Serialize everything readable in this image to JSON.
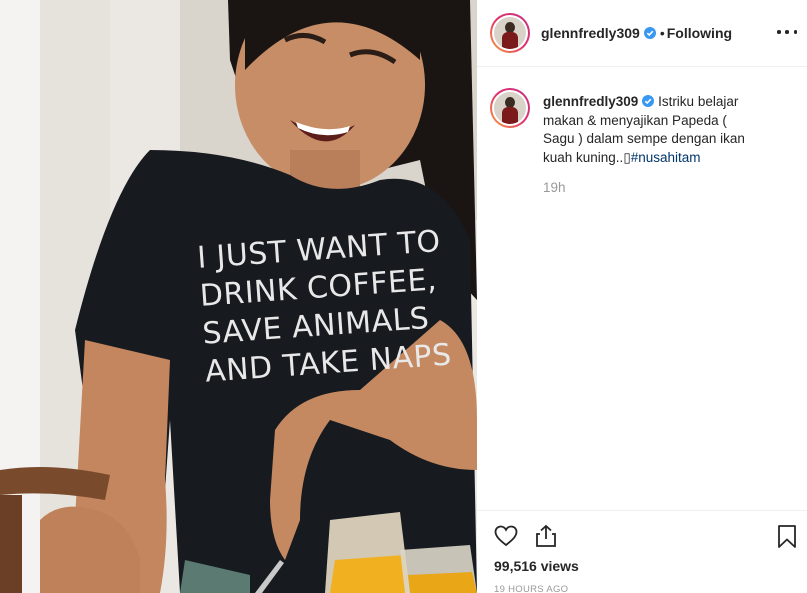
{
  "post": {
    "author": {
      "username": "glennfredly309",
      "verified": true
    },
    "follow_status": "Following",
    "separator": "•",
    "more_icon": "more-options-icon",
    "caption": {
      "text": "Istriku belajar makan & menyajikan Papeda ( Sagu ) dalam sempe dengan ikan kuah kuning..",
      "glyph": "▯",
      "hashtag": "#nusahitam",
      "time": "19h"
    },
    "actions": {
      "like_icon": "heart-icon",
      "share_icon": "share-icon",
      "save_icon": "bookmark-icon"
    },
    "views": "99,516 views",
    "timestamp": "19 HOURS AGO"
  },
  "media": {
    "shirt_text": [
      "I JUST WANT TO",
      "DRINK COFFEE,",
      "SAVE ANIMALS",
      "AND TAKE NAPS"
    ]
  },
  "colors": {
    "verified_blue": "#3897f0",
    "hashtag_blue": "#003569",
    "muted_gray": "#999999",
    "text": "#262626"
  }
}
